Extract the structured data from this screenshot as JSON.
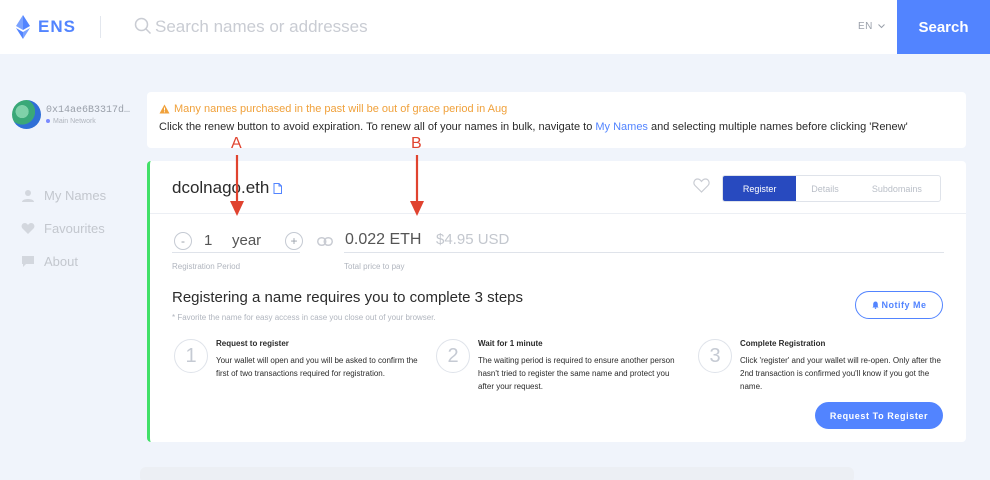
{
  "header": {
    "brand": "ENS",
    "search_placeholder": "Search names or addresses",
    "language": "EN",
    "search_button": "Search"
  },
  "account": {
    "address": "0x14ae6B3317d…",
    "network": "Main Network"
  },
  "sidebar": {
    "items": [
      {
        "label": "My Names",
        "icon": "user-icon"
      },
      {
        "label": "Favourites",
        "icon": "heart-icon"
      },
      {
        "label": "About",
        "icon": "chat-icon"
      }
    ]
  },
  "notice": {
    "warning": "Many names purchased in the past will be out of grace period in Aug",
    "text_before": "Click the renew button to avoid expiration. To renew all of your names in bulk, navigate to ",
    "link": "My Names",
    "text_after": " and selecting multiple names before clicking 'Renew'"
  },
  "card": {
    "name": "dcolnago.eth",
    "tabs": [
      "Register",
      "Details",
      "Subdomains"
    ],
    "active_tab": "Register",
    "period": {
      "minus": "-",
      "value": "1",
      "unit": "year",
      "plus": "+",
      "label": "Registration Period"
    },
    "price": {
      "eth": "0.022 ETH",
      "usd": "$4.95 USD",
      "label": "Total price to pay"
    },
    "steps_title": "Registering a name requires you to complete 3 steps",
    "steps_note": "* Favorite the name for easy access in case you close out of your browser.",
    "notify_button": "Notify Me",
    "steps": [
      {
        "number": "1",
        "title": "Request to register",
        "description": "Your wallet will open and you will be asked to confirm the first of two transactions required for registration."
      },
      {
        "number": "2",
        "title": "Wait for 1 minute",
        "description": "The waiting period is required to ensure another person hasn't tried to register the same name and protect you after your request."
      },
      {
        "number": "3",
        "title": "Complete Registration",
        "description": "Click 'register' and your wallet will re-open. Only after the 2nd transaction is confirmed you'll know if you got the name."
      }
    ],
    "request_button": "Request To Register"
  },
  "annotations": {
    "a": "A",
    "b": "B"
  },
  "colors": {
    "accent": "#5284ff",
    "active_tab": "#284abf",
    "card_border": "#42e068",
    "warning": "#f0a13b",
    "annotation": "#e0432f"
  }
}
